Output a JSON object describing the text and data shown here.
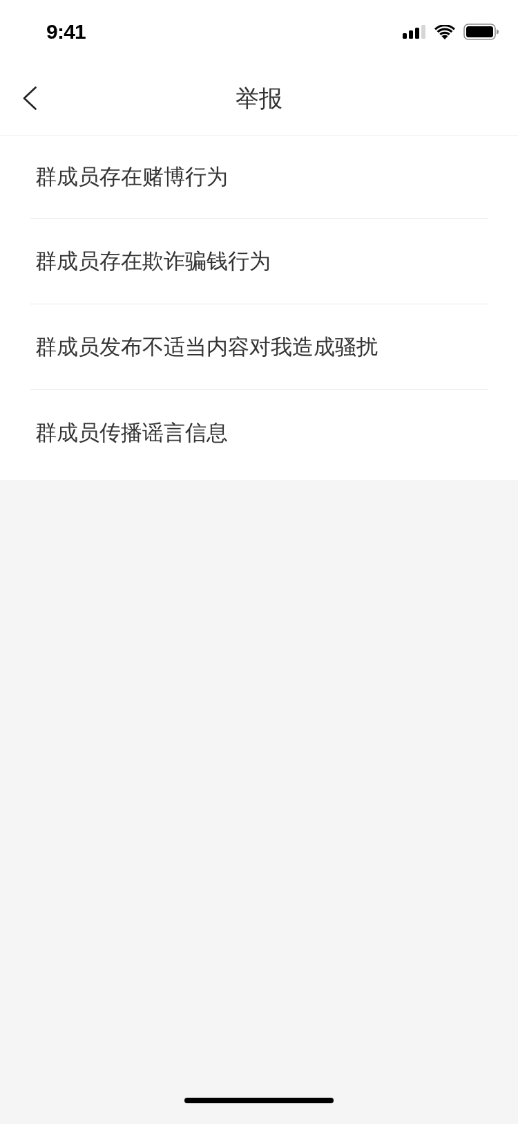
{
  "status_bar": {
    "time": "9:41"
  },
  "nav_bar": {
    "title": "举报"
  },
  "report_reasons": [
    {
      "label": "群成员存在赌博行为"
    },
    {
      "label": "群成员存在欺诈骗钱行为"
    },
    {
      "label": "群成员发布不适当内容对我造成骚扰"
    },
    {
      "label": "群成员传播谣言信息"
    }
  ]
}
